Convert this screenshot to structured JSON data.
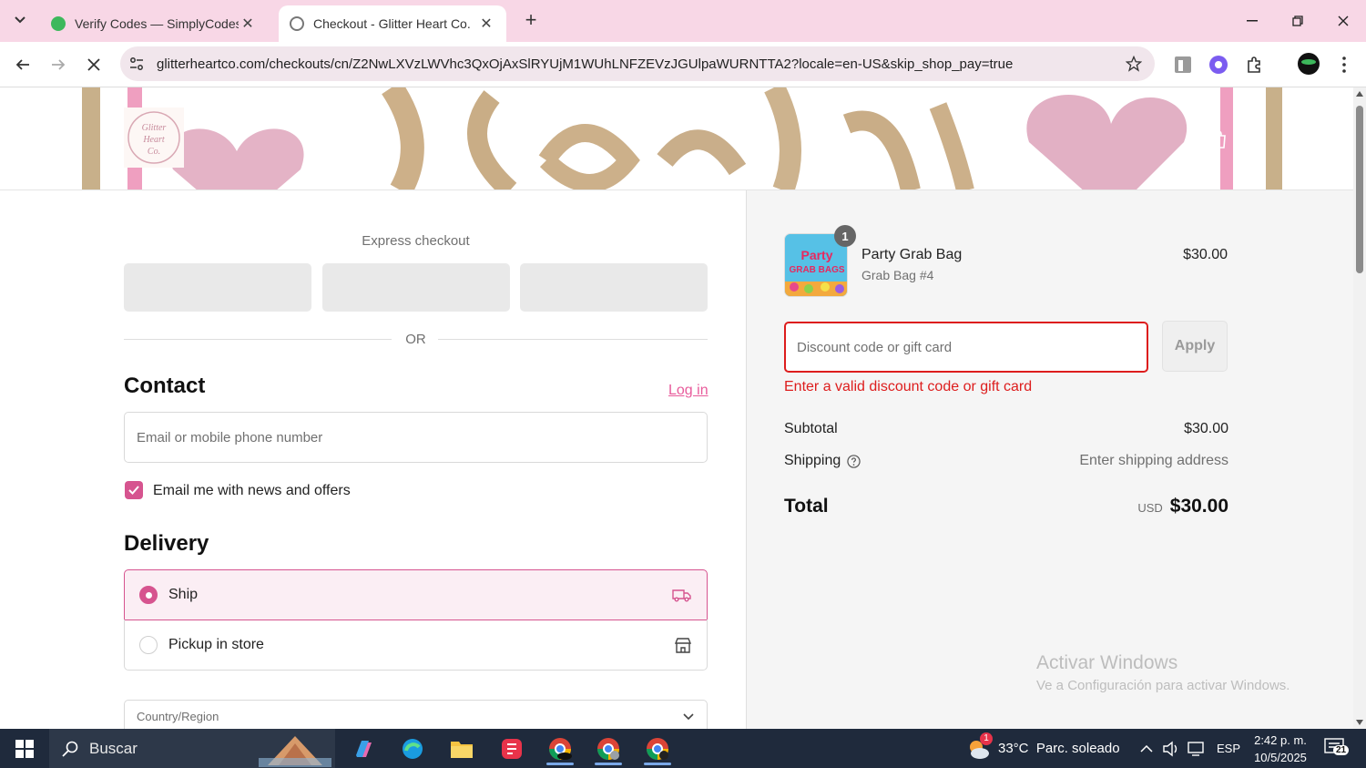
{
  "browser": {
    "tabs": [
      {
        "title": "Verify Codes — SimplyCodes",
        "active": false
      },
      {
        "title": "Checkout - Glitter Heart Co.",
        "active": true
      }
    ],
    "url": "glitterheartco.com/checkouts/cn/Z2NwLXVzLWVhc3QxOjAxSlRYUjM1WUhLNFZEVzJGUlpaWURNTTA2?locale=en-US&skip_shop_pay=true"
  },
  "store": {
    "logo_text": "Glitter Heart Co."
  },
  "express": {
    "title": "Express checkout",
    "or_label": "OR"
  },
  "contact": {
    "heading": "Contact",
    "login_link": "Log in",
    "email_placeholder": "Email or mobile phone number",
    "newsletter_label": "Email me with news and offers",
    "newsletter_checked": true
  },
  "delivery": {
    "heading": "Delivery",
    "options": [
      {
        "label": "Ship",
        "selected": true
      },
      {
        "label": "Pickup in store",
        "selected": false
      }
    ],
    "country_label": "Country/Region"
  },
  "summary": {
    "item": {
      "name": "Party Grab Bag",
      "variant": "Grab Bag #4",
      "price": "$30.00",
      "quantity": "1",
      "thumb_text": "Party GRAB BAGS"
    },
    "discount_placeholder": "Discount code or gift card",
    "apply_label": "Apply",
    "error": "Enter a valid discount code or gift card",
    "subtotal_label": "Subtotal",
    "subtotal_value": "$30.00",
    "shipping_label": "Shipping",
    "shipping_value": "Enter shipping address",
    "total_label": "Total",
    "currency": "USD",
    "total_value": "$30.00"
  },
  "watermark": {
    "line1": "Activar Windows",
    "line2": "Ve a Configuración para activar Windows."
  },
  "taskbar": {
    "search_label": "Buscar",
    "weather": "33°C  Parc. soleado",
    "weather_badge": "1",
    "lang": "ESP",
    "time": "2:42 p. m.",
    "date": "10/5/2025",
    "notif_count": "21"
  },
  "colors": {
    "accent": "#d6548f",
    "error": "#dd1d1d",
    "tabstrip": "#f8d7e6"
  }
}
